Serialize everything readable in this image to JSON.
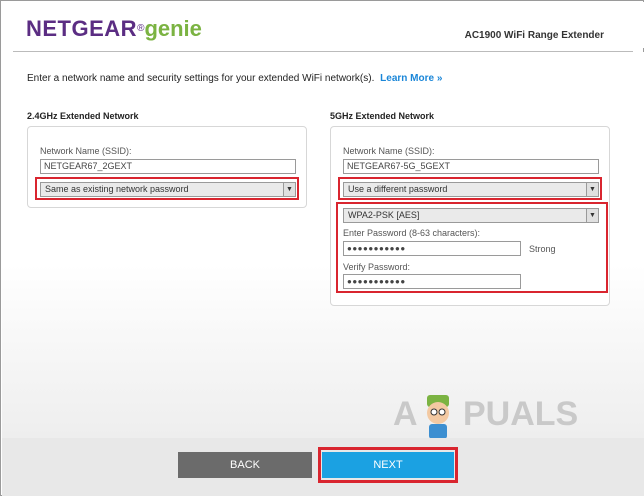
{
  "header": {
    "brand": "NETGEAR",
    "brand_reg": "®",
    "genie": "genie",
    "product": "AC1900 WiFi Range Extender"
  },
  "intro": {
    "text": "Enter a network name and security settings for your extended WiFi network(s).",
    "learn_more": "Learn More »"
  },
  "band_24": {
    "title": "2.4GHz Extended Network",
    "ssid_label": "Network Name (SSID):",
    "ssid_value": "NETGEAR67_2GEXT",
    "password_option": "Same as existing network password"
  },
  "band_5": {
    "title": "5GHz Extended Network",
    "ssid_label": "Network Name (SSID):",
    "ssid_value": "NETGEAR67-5G_5GEXT",
    "password_option": "Use a different password",
    "security_option": "WPA2-PSK [AES]",
    "password_label": "Enter Password (8-63 characters):",
    "password_value": "●●●●●●●●●●●",
    "strength": "Strong",
    "verify_label": "Verify Password:",
    "verify_value": "●●●●●●●●●●●"
  },
  "footer": {
    "back_label": "BACK",
    "next_label": "NEXT"
  },
  "watermark": {
    "left": "A",
    "right": "PUALS"
  },
  "colors": {
    "brand_purple": "#5b2d83",
    "genie_green": "#7bb342",
    "link_blue": "#1a86d8",
    "next_blue": "#1ba1e2",
    "back_gray": "#6b6b6b",
    "highlight_red": "#d9252f"
  }
}
